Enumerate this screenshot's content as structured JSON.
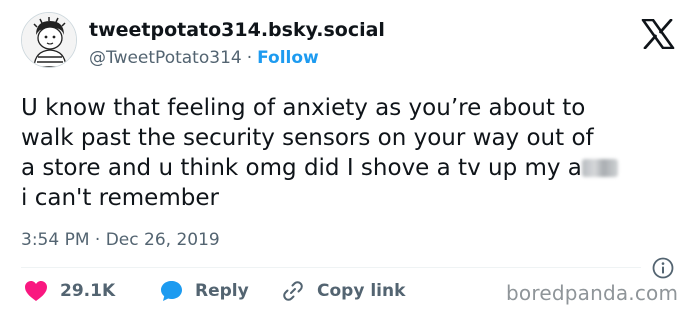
{
  "author": {
    "display_name": "tweetpotato314.bsky.social",
    "handle": "@TweetPotato314",
    "separator": "·",
    "follow_label": "Follow",
    "avatar_icon": "cartoon-child-avatar"
  },
  "platform_icon": "x-logo-icon",
  "tweet": {
    "lines": [
      "U know that feeling of anxiety as you’re about to",
      "walk past the security sensors on your way out of",
      "a store and u think omg did I shove a tv up my a",
      "i can't remember"
    ]
  },
  "timestamp": {
    "time": "3:54 PM",
    "separator": "·",
    "date": "Dec 26, 2019"
  },
  "actions": {
    "like_count": "29.1K",
    "reply_label": "Reply",
    "copy_label": "Copy link"
  },
  "watermark": "boredpanda.com",
  "colors": {
    "text": "#0f1419",
    "secondary": "#536471",
    "link": "#1d9bf0",
    "like": "#f91880",
    "reply": "#1d9bf0"
  }
}
